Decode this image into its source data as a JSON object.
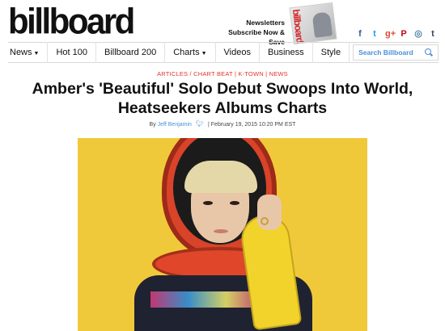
{
  "header": {
    "logo": "billboard",
    "newsletter_line1": "Newsletters",
    "newsletter_line2": "Subscribe Now & Save",
    "magazine_title": "billboard",
    "social_icons": [
      "facebook-icon",
      "twitter-icon",
      "google-plus-icon",
      "pinterest-icon",
      "instagram-icon",
      "tumblr-icon"
    ],
    "social_glyphs": [
      "f",
      "t",
      "g+",
      "P",
      "◎",
      "t"
    ],
    "social_colors": [
      "#3b5998",
      "#1da1f2",
      "#dd4b39",
      "#bd081c",
      "#517fa4",
      "#35465c"
    ]
  },
  "nav": {
    "items": [
      {
        "label": "News",
        "has_dropdown": true
      },
      {
        "label": "Hot 100",
        "has_dropdown": false
      },
      {
        "label": "Billboard 200",
        "has_dropdown": false
      },
      {
        "label": "Charts",
        "has_dropdown": true
      },
      {
        "label": "Videos",
        "has_dropdown": false
      },
      {
        "label": "Business",
        "has_dropdown": false
      },
      {
        "label": "Style",
        "has_dropdown": false
      }
    ],
    "search_placeholder": "Search Billboard"
  },
  "article": {
    "breadcrumb": [
      "ARTICLES",
      "CHART BEAT",
      "K-TOWN",
      "NEWS"
    ],
    "title": "Amber's 'Beautiful' Solo Debut Swoops Into World, Heatseekers Albums Charts",
    "by": "By",
    "author": "Jeff Benjamin",
    "date": "February 19, 2015 10:20 PM EST"
  },
  "colors": {
    "accent_red": "#e0352e",
    "link_blue": "#4a8fd9",
    "hero_background": "#f0c93a"
  }
}
